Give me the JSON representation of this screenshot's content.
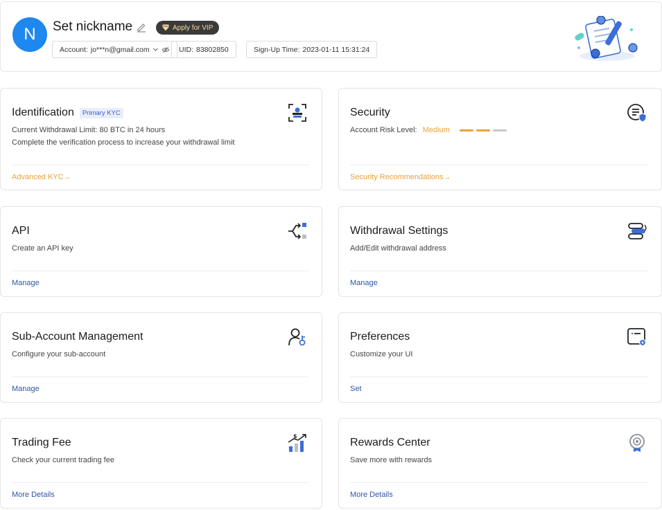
{
  "profile": {
    "avatar_letter": "N",
    "nickname": "Set nickname",
    "vip_label": "Apply for VIP",
    "account_label": "Account:",
    "account_value": "jo***n@gmail.com",
    "uid_label": "UID:",
    "uid_value": "83802850",
    "signup_label": "Sign-Up Time:",
    "signup_value": "2023-01-11 15:31:24"
  },
  "cards": {
    "identification": {
      "title": "Identification",
      "badge": "Primary KYC",
      "line1": "Current Withdrawal Limit: 80 BTC in 24 hours",
      "line2": "Complete the verification process to increase your withdrawal limit",
      "link": "Advanced KYC→"
    },
    "security": {
      "title": "Security",
      "risk_label": "Account Risk Level:",
      "risk_value": "Medium",
      "risk_level": 2,
      "risk_max": 3,
      "link": "Security Recommendations→"
    },
    "api": {
      "title": "API",
      "line1": "Create an API key",
      "link": "Manage"
    },
    "withdrawal": {
      "title": "Withdrawal Settings",
      "line1": "Add/Edit withdrawal address",
      "link": "Manage"
    },
    "subaccount": {
      "title": "Sub-Account Management",
      "line1": "Configure your sub-account",
      "link": "Manage"
    },
    "preferences": {
      "title": "Preferences",
      "line1": "Customize your UI",
      "link": "Set"
    },
    "tradingfee": {
      "title": "Trading Fee",
      "line1": "Check your current trading fee",
      "link": "More Details"
    },
    "rewards": {
      "title": "Rewards Center",
      "line1": "Save more with rewards",
      "link": "More Details"
    }
  },
  "colors": {
    "accent": "#1e87f0",
    "link": "#3056a5",
    "warning": "#e9a23b",
    "icon_blue": "#3b6fd6"
  },
  "icons": [
    "edit-icon",
    "diamond-icon",
    "chevron-down-icon",
    "eye-hidden-icon",
    "id-scan-icon",
    "shield-list-icon",
    "api-icon",
    "withdrawal-icon",
    "sub-account-icon",
    "preferences-icon",
    "trading-fee-icon",
    "rewards-icon"
  ]
}
